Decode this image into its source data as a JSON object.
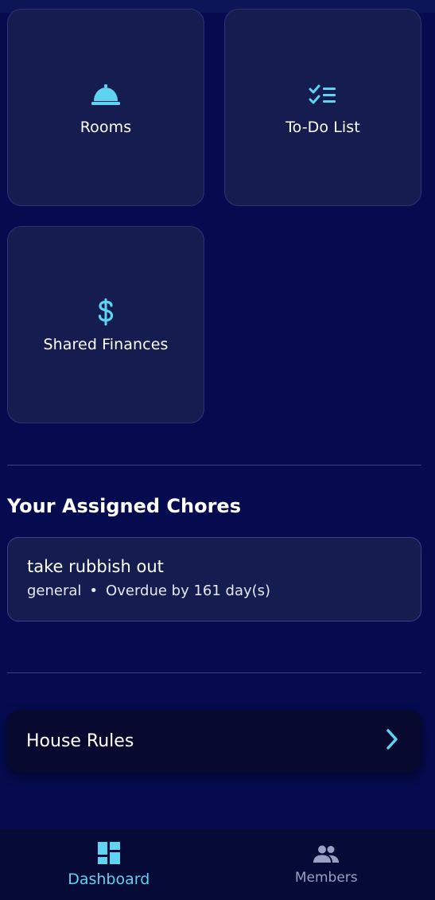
{
  "colors": {
    "accent": "#5fd3f0",
    "background": "#050b4e",
    "tile": "#151c4f",
    "inactive": "#9aa0c4"
  },
  "tiles": [
    {
      "label": "Rooms",
      "icon": "room-service-bell-icon"
    },
    {
      "label": "To-Do List",
      "icon": "checklist-icon"
    },
    {
      "label": "Shared Finances",
      "icon": "dollar-icon"
    }
  ],
  "chores": {
    "title": "Your Assigned Chores",
    "items": [
      {
        "name": "take rubbish out",
        "category": "general",
        "separator": "•",
        "status": "Overdue by 161 day(s)"
      }
    ]
  },
  "house_rules": {
    "label": "House Rules",
    "icon": "chevron-right-icon"
  },
  "nav": [
    {
      "label": "Dashboard",
      "icon": "dashboard-icon",
      "active": true
    },
    {
      "label": "Members",
      "icon": "people-icon",
      "active": false
    }
  ]
}
